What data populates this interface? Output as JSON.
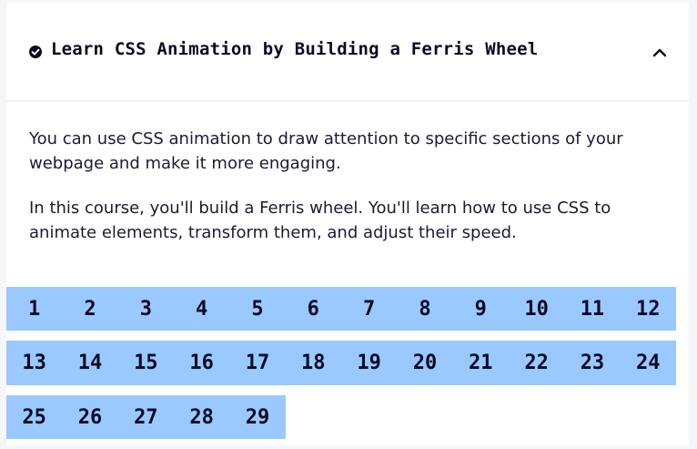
{
  "header": {
    "title": "Learn CSS Animation by Building a Ferris Wheel",
    "status_icon": "check-circle-icon",
    "toggle_icon": "chevron-up-icon"
  },
  "description": [
    "You can use CSS animation to draw attention to specific sections of your webpage and make it more engaging.",
    "In this course, you'll build a Ferris wheel. You'll learn how to use CSS to animate elements, transform them, and adjust their speed."
  ],
  "steps": {
    "rows": [
      [
        "1",
        "2",
        "3",
        "4",
        "5",
        "6",
        "7",
        "8",
        "9",
        "10",
        "11",
        "12"
      ],
      [
        "13",
        "14",
        "15",
        "16",
        "17",
        "18",
        "19",
        "20",
        "21",
        "22",
        "23",
        "24"
      ],
      [
        "25",
        "26",
        "27",
        "28",
        "29"
      ]
    ]
  },
  "colors": {
    "step_bg": "#99c9ff",
    "text": "#0a0a23",
    "card_bg": "#ffffff",
    "page_bg": "#f5f6f7"
  }
}
